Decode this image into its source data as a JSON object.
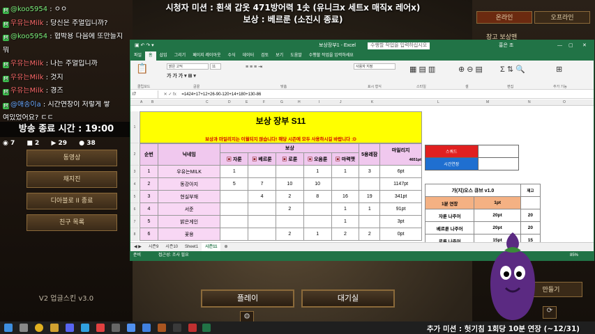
{
  "banner": {
    "line1": "시청자 미션 : 흰색 갑옷 471방어력 1솟 (유니크x 세트x 매직x 레어x)",
    "line2": "보상 : 베르룬 (소진시 종료)"
  },
  "chat": [
    {
      "user": "@koo5954",
      "text": " : ㅇㅇ",
      "cls": "u2"
    },
    {
      "user": "우유는Milk",
      "text": " : 당신은 주얼입니까?",
      "cls": "u"
    },
    {
      "user": "@koo5954",
      "text": " : 협박용 다음에 또만들지",
      "cls": "u2"
    },
    {
      "user": "",
      "text": "뭐",
      "cls": ""
    },
    {
      "user": "우유는Milk",
      "text": " : 나는 주얼입니까",
      "cls": "u"
    },
    {
      "user": "우유는Milk",
      "text": " : 것지",
      "cls": "u"
    },
    {
      "user": "우유는Milk",
      "text": " : 경즈",
      "cls": "u"
    },
    {
      "user": "@애송이a",
      "text": " : 시간연장이 저렇게 쌓",
      "cls": "u3"
    },
    {
      "user": "",
      "text": "여있었어요? ㄷㄷ",
      "cls": ""
    }
  ],
  "end_time": "방송 종료 시간 : 19:00",
  "stats": [
    "7",
    "2",
    "29",
    "38"
  ],
  "left_menu": [
    "동영상",
    "채지진",
    "디아블로 II 종료",
    "친구 목록"
  ],
  "version": "V2 업글스킨 v3.0",
  "right_panel": {
    "tab_online": "온라인",
    "tab_offline": "오프라인",
    "stash": "창고 보상맨",
    "create": "만들기"
  },
  "excel": {
    "title": "보상장부1 - Excel",
    "search": "수행할 작업을 입력하십시오",
    "user": "홍은 조",
    "tabs": [
      "파일",
      "홈",
      "삽입",
      "그리기",
      "페이지 레이아웃",
      "수식",
      "데이터",
      "검토",
      "보기",
      "도움말",
      "수행할 작업을 입력하세요"
    ],
    "ribbon_groups": [
      "클립보드",
      "글꼴",
      "맞춤",
      "표시 형식",
      "스타일",
      "셀",
      "편집",
      "추가 기능"
    ],
    "font_name": "맑은 고딕",
    "font_size": "11",
    "number_format": "사용자 지정",
    "cell_ref": "I7",
    "formula": "=1424+17+12+26-90-120+14+180+130-86",
    "columns": [
      "A",
      "B",
      "C",
      "D",
      "E",
      "F",
      "G",
      "H",
      "I",
      "J",
      "K",
      "L",
      "M",
      "N",
      "O"
    ],
    "sheet_title": "보상 장부 S11",
    "sheet_notice": "보상과 마일리지는 이월되지 않습니다! 해당 시즌에 모두 사용하시길 바랍니다 :D",
    "headers": {
      "no": "순번",
      "nick": "닉네임",
      "reward": "보상",
      "items": [
        "자룬",
        "베르룬",
        "로룬",
        "오움룬",
        "마력맷"
      ],
      "boss": "5용레잠",
      "mileage": "마일리지",
      "mileage_total": "4651pt"
    },
    "rows": [
      {
        "no": "1",
        "nick": "우유는MILK",
        "v": [
          "1",
          "",
          "",
          "1",
          "1"
        ],
        "boss": "3",
        "mil": "6pt"
      },
      {
        "no": "2",
        "nick": "동강아지",
        "v": [
          "5",
          "7",
          "10",
          "10",
          ""
        ],
        "boss": "",
        "mil": "1147pt"
      },
      {
        "no": "3",
        "nick": "현실부재",
        "v": [
          "",
          "4",
          "2",
          "8",
          "16"
        ],
        "boss": "19",
        "mil": "341pt"
      },
      {
        "no": "4",
        "nick": "서준",
        "v": [
          "",
          "",
          "2",
          "",
          "1"
        ],
        "boss": "1",
        "mil": "91pt"
      },
      {
        "no": "5",
        "nick": "밝은게인",
        "v": [
          "",
          "",
          "",
          "",
          "1"
        ],
        "boss": "",
        "mil": "3pt"
      },
      {
        "no": "6",
        "nick": "꽃용",
        "v": [
          "",
          "",
          "2",
          "1",
          "2"
        ],
        "boss": "2",
        "mil": "0pt"
      }
    ],
    "side": {
      "squad": "스쿼드",
      "time_ext": "시간연장"
    },
    "cube": {
      "title": "가(지)오스 큐브 v1.0",
      "col3": "재고",
      "head": [
        "1분 연장",
        "1pt"
      ],
      "rows": [
        [
          "자룬 나주어",
          "20pt",
          "20"
        ],
        [
          "베르룬 나주어",
          "20pt",
          "20"
        ],
        [
          "로룬 나주어",
          "15pt",
          "15"
        ]
      ]
    },
    "sheet_tabs": [
      "시즌9",
      "시즌10",
      "Sheet1",
      "시즌11"
    ],
    "status_left": "준비",
    "status_mid": "접근성: 조사 필요",
    "zoom": "85%"
  },
  "game": {
    "play": "플레이",
    "lobby": "대기실"
  },
  "ticker": "추가 미션 : 헛기침 1회당 10분 연장 (~12/31)",
  "colors": {
    "excel_green": "#217346",
    "title_yellow": "#ffff00",
    "header_pink": "#f0c8ee",
    "squad_red": "#e02020",
    "timeext_blue": "#1f6fd0",
    "cube_orange": "#f4b183"
  }
}
